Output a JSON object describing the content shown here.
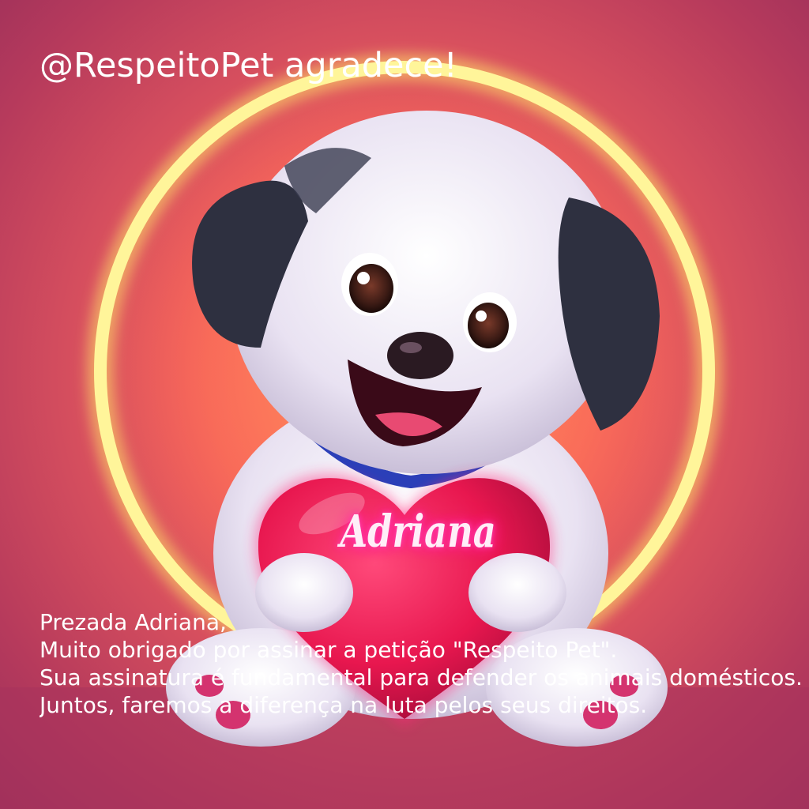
{
  "headline": "@RespeitoPet agradece!",
  "heart_name": "Adriana",
  "message": {
    "line1": "Prezada Adriana,",
    "line2": "Muito obrigado por assinar a petição \"Respeito Pet\".",
    "line3": "Sua assinatura é fundamental para defender os animais domésticos.",
    "line4": "Juntos, faremos a diferença na luta pelos seus direitos."
  },
  "colors": {
    "background": "#d8505e",
    "glow_ring": "#fff27a",
    "heart": "#e8174f",
    "neon_text": "#ff3fb0",
    "text": "#ffffff"
  }
}
